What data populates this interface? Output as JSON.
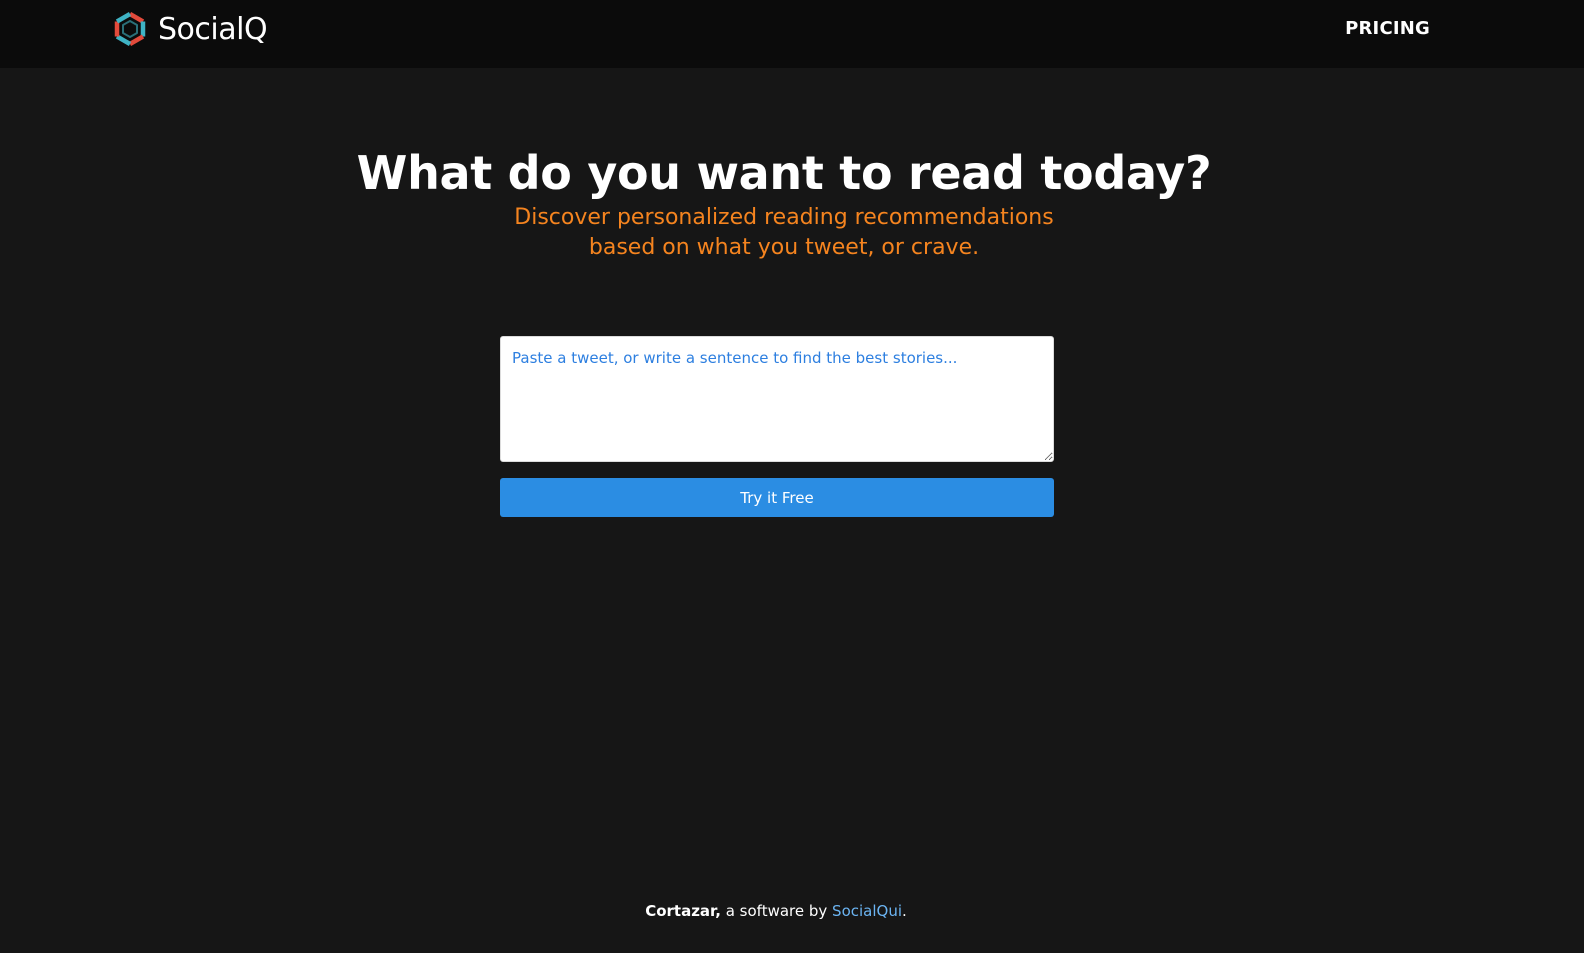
{
  "header": {
    "brand_name": "SocialQ",
    "logo_icon": "hexagon-swirl-logo-icon",
    "nav": {
      "pricing_label": "PRICING"
    }
  },
  "hero": {
    "title": "What do you want to read today?",
    "subtitle_line1": "Discover personalized reading recommendations",
    "subtitle_line2": "based on what you tweet, or crave."
  },
  "search": {
    "value": "",
    "placeholder": "Paste a tweet, or write a sentence to find the best stories...",
    "submit_label": "Try it Free"
  },
  "footer": {
    "product_name": "Cortazar,",
    "middle_text": " a software by ",
    "company_link": "SocialQui",
    "end_text": "."
  },
  "colors": {
    "background": "#161616",
    "navbar": "#0b0b0b",
    "accent_orange": "#f5841f",
    "button_blue": "#2b8de3",
    "link_blue": "#6bb4f2",
    "logo_red": "#e24a3b",
    "logo_teal": "#3fb3c4"
  }
}
